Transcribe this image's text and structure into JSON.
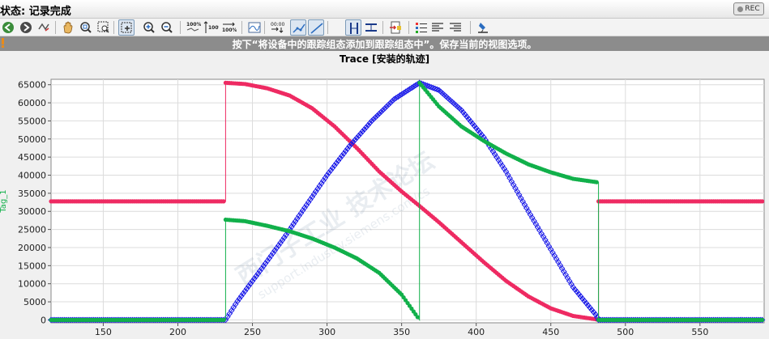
{
  "status": {
    "label": "状态: 记录完成",
    "rec_label": "REC"
  },
  "toolbar": {
    "buttons": [
      {
        "name": "back-arrow-icon"
      },
      {
        "name": "forward-arrow-icon"
      },
      {
        "name": "reset-view-icon"
      },
      {
        "name": "pan-hand-icon"
      },
      {
        "name": "zoom-region-icon"
      },
      {
        "name": "zoom-rect-icon"
      },
      {
        "name": "zoom-select-icon",
        "pressed": true
      },
      {
        "name": "zoom-in-icon"
      },
      {
        "name": "zoom-out-icon"
      },
      {
        "name": "zoom-x-100-icon"
      },
      {
        "name": "zoom-y-100-icon"
      },
      {
        "name": "zoom-xy-100-icon"
      },
      {
        "name": "curve-display-icon"
      },
      {
        "name": "time-cursor-icon"
      },
      {
        "name": "line-points-icon",
        "pressed": true
      },
      {
        "name": "line-only-icon",
        "pressed": true
      },
      {
        "name": "vertical-cursor-icon",
        "pressed": true
      },
      {
        "name": "horizontal-cursor-icon"
      },
      {
        "name": "export-snapshot-icon"
      },
      {
        "name": "legend-list-icon"
      },
      {
        "name": "align-left-icon"
      },
      {
        "name": "align-right-icon"
      },
      {
        "name": "save-trace-icon"
      }
    ]
  },
  "hint": {
    "text": "按下“将设备中的跟踪组态添加到跟踪组态中”。保存当前的视图选项。"
  },
  "watermark": {
    "text": "西门子工业  技术论坛",
    "url": "support.industry.siemens.com/cs"
  },
  "colors": {
    "red": "#ee2a62",
    "blue": "#1a1ae8",
    "green": "#11b04a",
    "grid": "#dcdcdc",
    "plot_bg": "#ffffff"
  },
  "chart_data": {
    "type": "line",
    "title": "Trace [安装的轨迹]",
    "ylabel": "Tag_1",
    "xlim": [
      115,
      593
    ],
    "ylim": [
      -800,
      66500
    ],
    "x_ticks": [
      150,
      200,
      250,
      300,
      350,
      400,
      450,
      500,
      550
    ],
    "y_ticks": [
      0,
      5000,
      10000,
      15000,
      20000,
      25000,
      30000,
      35000,
      40000,
      45000,
      50000,
      55000,
      60000,
      65000
    ],
    "series": [
      {
        "color": "red",
        "points": [
          [
            115,
            32767
          ],
          [
            232,
            32767
          ],
          [
            232,
            65535
          ],
          [
            245,
            65200
          ],
          [
            260,
            64000
          ],
          [
            275,
            62000
          ],
          [
            290,
            58500
          ],
          [
            305,
            53500
          ],
          [
            320,
            47500
          ],
          [
            335,
            41000
          ],
          [
            350,
            35500
          ],
          [
            362,
            31500
          ],
          [
            375,
            27000
          ],
          [
            390,
            21500
          ],
          [
            405,
            16000
          ],
          [
            420,
            10800
          ],
          [
            435,
            6500
          ],
          [
            450,
            3200
          ],
          [
            465,
            1100
          ],
          [
            480,
            200
          ],
          [
            482,
            0
          ],
          [
            482,
            32767
          ],
          [
            593,
            32767
          ]
        ]
      },
      {
        "color": "blue",
        "points": [
          [
            115,
            0
          ],
          [
            232,
            0
          ],
          [
            240,
            5200
          ],
          [
            255,
            13500
          ],
          [
            270,
            22000
          ],
          [
            285,
            31000
          ],
          [
            300,
            40000
          ],
          [
            315,
            48000
          ],
          [
            330,
            55000
          ],
          [
            345,
            61000
          ],
          [
            362,
            65535
          ],
          [
            375,
            63500
          ],
          [
            390,
            58000
          ],
          [
            405,
            50500
          ],
          [
            420,
            41000
          ],
          [
            435,
            30000
          ],
          [
            450,
            19500
          ],
          [
            465,
            9000
          ],
          [
            480,
            1500
          ],
          [
            482,
            0
          ],
          [
            593,
            0
          ]
        ]
      },
      {
        "color": "green",
        "points": [
          [
            115,
            0
          ],
          [
            232,
            0
          ],
          [
            232,
            27700
          ],
          [
            245,
            27300
          ],
          [
            260,
            26000
          ],
          [
            275,
            24500
          ],
          [
            290,
            22500
          ],
          [
            305,
            20000
          ],
          [
            320,
            17000
          ],
          [
            335,
            13000
          ],
          [
            350,
            7000
          ],
          [
            362,
            0
          ],
          [
            362,
            65535
          ],
          [
            375,
            59000
          ],
          [
            390,
            53500
          ],
          [
            405,
            49500
          ],
          [
            420,
            46000
          ],
          [
            435,
            43000
          ],
          [
            450,
            40800
          ],
          [
            465,
            39000
          ],
          [
            482,
            38000
          ],
          [
            482,
            0
          ],
          [
            593,
            0
          ]
        ]
      }
    ]
  }
}
